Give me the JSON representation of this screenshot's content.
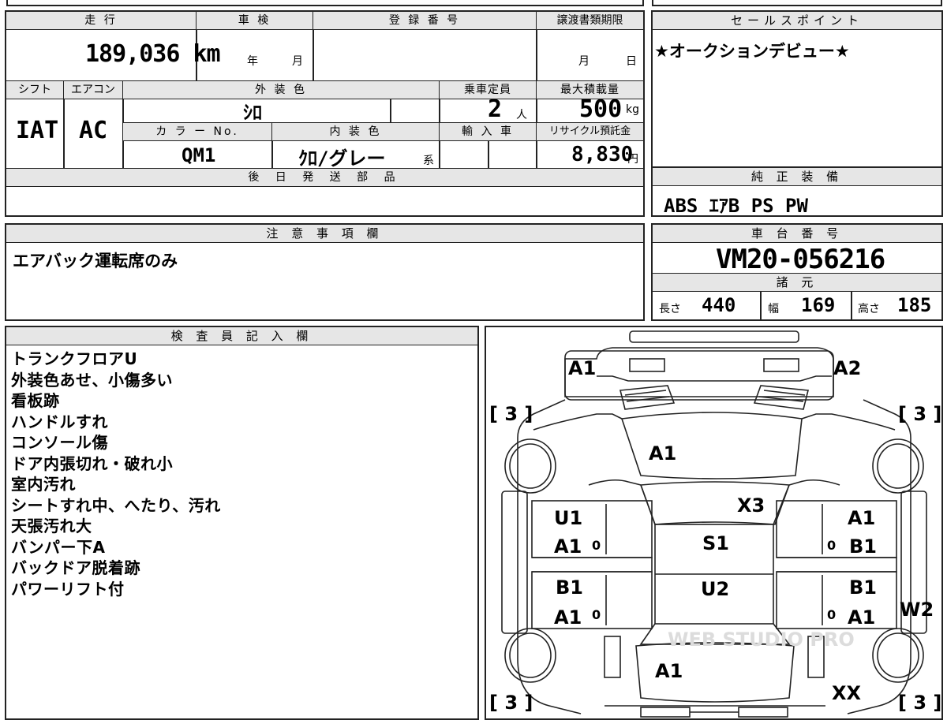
{
  "top_strip": {
    "partial_text": "車 台 番 号"
  },
  "vehicle": {
    "mileage_label": "走 行",
    "mileage": "189,036",
    "mileage_unit": "km",
    "inspection_label": "車 検",
    "inspection_year": "年",
    "inspection_month": "月",
    "registration_label": "登 録 番 号",
    "transfer_label": "譲渡書類期限",
    "transfer_month": "月",
    "transfer_day": "日",
    "shift_label": "シフト",
    "shift": "IAT",
    "aircon_label": "エアコン",
    "aircon": "AC",
    "exterior_label": "外 装 色",
    "exterior": "ｼﾛ",
    "capacity_label": "乗車定員",
    "capacity": "2",
    "capacity_unit": "人",
    "load_label": "最大積載量",
    "load": "500",
    "load_unit": "kg",
    "color_no_label": "カ ラ ー No.",
    "color_no": "QM1",
    "interior_label": "内 装 色",
    "interior": "ｸﾛ/グレー",
    "interior_suffix": "系",
    "import_label": "輸 入 車",
    "recycle_label": "リサイクル預託金",
    "recycle": "8,830",
    "recycle_unit": "円",
    "later_parts_label": "後 日 発 送 部 品"
  },
  "sales_point": {
    "label": "セールスポイント",
    "text": "★オークションデビュー★"
  },
  "equipment": {
    "label": "純 正 装 備",
    "text": "ABS ｴｱB PS PW"
  },
  "caution": {
    "label": "注 意 事 項 欄",
    "text": "エアバック運転席のみ"
  },
  "chassis": {
    "label": "車 台 番 号",
    "number": "VM20-056216",
    "spec_label": "諸 元",
    "length_label": "長さ",
    "length": "440",
    "width_label": "幅",
    "width": "169",
    "height_label": "高さ",
    "height": "185"
  },
  "inspector": {
    "label": "検 査 員 記 入 欄",
    "notes": [
      "トランクフロアU",
      "外装色あせ、小傷多い",
      "看板跡",
      "ハンドルすれ",
      "コンソール傷",
      "ドア内張切れ・破れ小",
      "室内汚れ",
      "シートすれ中、へたり、汚れ",
      "天張汚れ大",
      "バンパー下A",
      "バックドア脱着跡",
      "パワーリフト付"
    ]
  },
  "diagram": {
    "marks": {
      "front_left": "A1",
      "front_right": "A2",
      "tire_fl": "[ 3 ]",
      "tire_fr": "[ 3 ]",
      "tire_rl": "[ 3 ]",
      "tire_rr": "[ 3 ]",
      "hood": "A1",
      "windshield_right": "X3",
      "door_fl_top": "U1",
      "door_fl_bottom": "A1",
      "door_fr_top": "A1",
      "door_fr_bottom": "B1",
      "roof_front": "S1",
      "roof_rear": "U2",
      "door_rl_top": "B1",
      "door_rl_bottom": "A1",
      "door_rr_top": "B1",
      "door_rr_bottom": "A1",
      "side_right": "W2",
      "rear": "A1",
      "rear_right": "XX",
      "zero_marks": [
        "0",
        "0",
        "0",
        "0"
      ]
    },
    "watermark": "WEB STUDIO PRO"
  }
}
